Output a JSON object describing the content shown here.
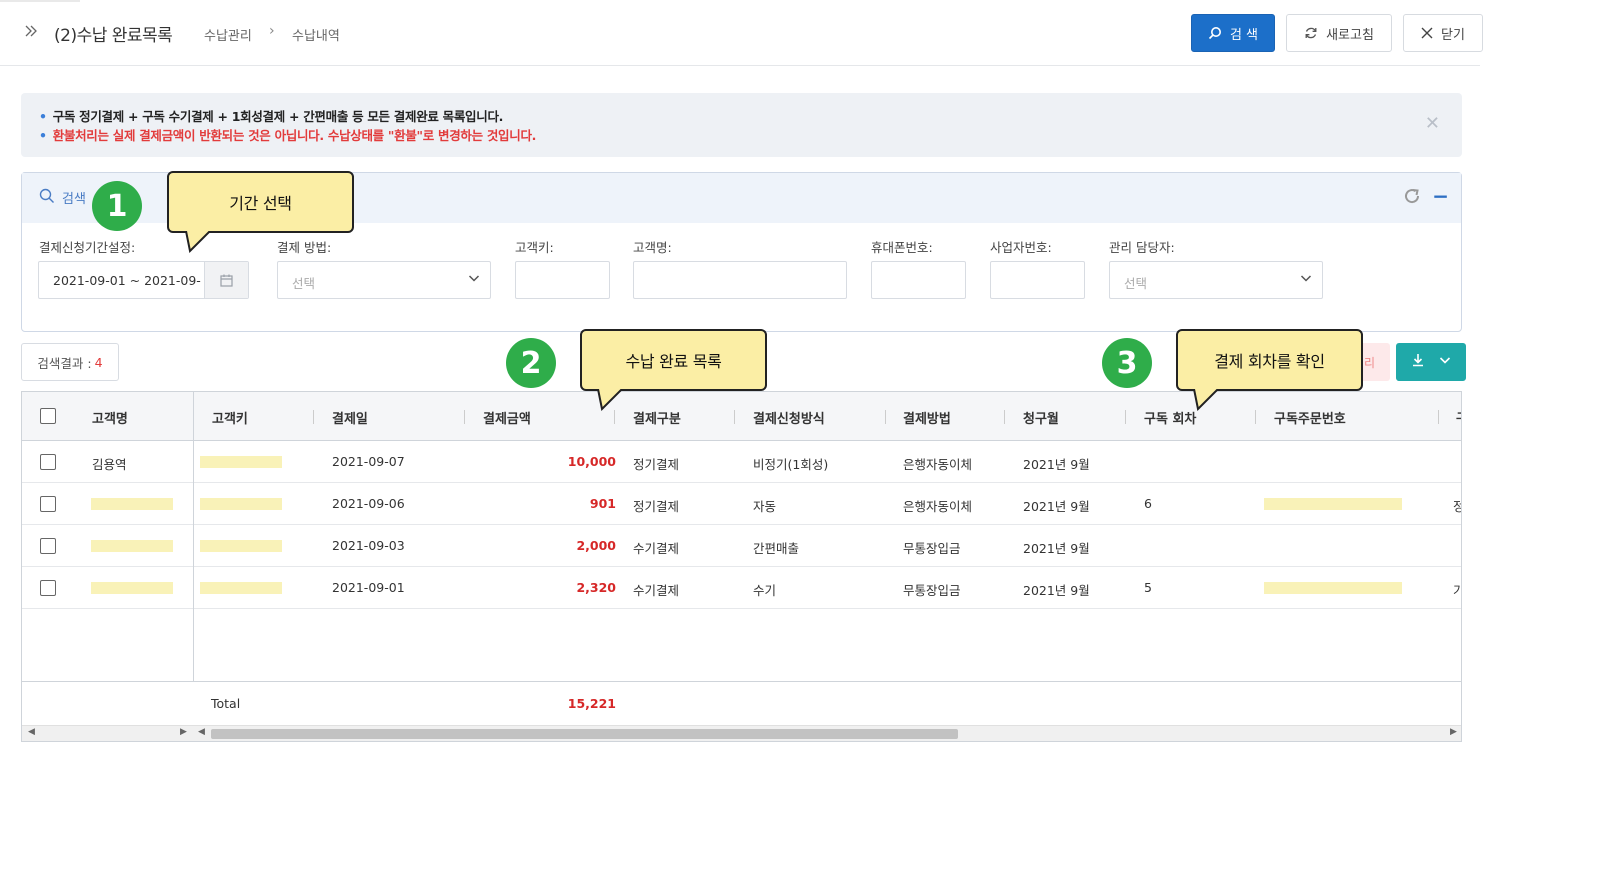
{
  "header": {
    "title": "(2)수납 완료목록",
    "breadcrumb": [
      "수납관리",
      "수납내역"
    ],
    "search_label": "검 색",
    "refresh_label": "새로고침",
    "close_label": "닫기"
  },
  "banner": {
    "line1": "구독 정기결제 + 구독 수기결제 + 1회성결제 + 간편매출 등 모든 결제완료 목록입니다.",
    "line2": "환불처리는 실제 결제금액이 반환되는 것은 아닙니다. 수납상태를 \"환불\"로 변경하는 것입니다."
  },
  "search": {
    "title": "검색",
    "fields": {
      "period_label": "결제신청기간설정:",
      "period_value": "2021-09-01 ~ 2021-09-",
      "method_label": "결제 방법:",
      "method_placeholder": "선택",
      "customer_key_label": "고객키:",
      "customer_name_label": "고객명:",
      "phone_label": "휴대폰번호:",
      "biz_no_label": "사업자번호:",
      "manager_label": "관리 담당자:",
      "manager_placeholder": "선택"
    }
  },
  "results": {
    "count_label": "검색결과 :",
    "count": "4",
    "pink_button_label": "리"
  },
  "grid": {
    "columns": [
      "고객명",
      "고객키",
      "결제일",
      "결제금액",
      "결제구분",
      "결제신청방식",
      "결제방법",
      "청구월",
      "구독 회차",
      "구독주문번호",
      "구"
    ],
    "rows": [
      {
        "name": "김용역",
        "date": "2021-09-07",
        "amount": "10,000",
        "type": "정기결제",
        "request": "비정기(1회성)",
        "method": "은행자동이체",
        "month": "2021년 9월",
        "round": "",
        "extra": ""
      },
      {
        "name": "",
        "date": "2021-09-06",
        "amount": "901",
        "type": "정기결제",
        "request": "자동",
        "method": "은행자동이체",
        "month": "2021년 9월",
        "round": "6",
        "extra": "정"
      },
      {
        "name": "",
        "date": "2021-09-03",
        "amount": "2,000",
        "type": "수기결제",
        "request": "간편매출",
        "method": "무통장입금",
        "month": "2021년 9월",
        "round": "",
        "extra": ""
      },
      {
        "name": "",
        "date": "2021-09-01",
        "amount": "2,320",
        "type": "수기결제",
        "request": "수기",
        "method": "무통장입금",
        "month": "2021년 9월",
        "round": "5",
        "extra": "기"
      }
    ],
    "footer_label": "Total",
    "footer_total": "15,221"
  },
  "annotations": [
    {
      "number": "1",
      "text": "기간 선택"
    },
    {
      "number": "2",
      "text": "수납 완료 목록"
    },
    {
      "number": "3",
      "text": "결제 회차를 확인"
    }
  ],
  "colors": {
    "primary": "#1c6fc9",
    "teal": "#1fa9a9",
    "amount_red": "#d62828",
    "badge_green": "#2fad4a",
    "bubble_yellow": "#fbeea5",
    "mask_yellow": "#f9f2b8"
  }
}
